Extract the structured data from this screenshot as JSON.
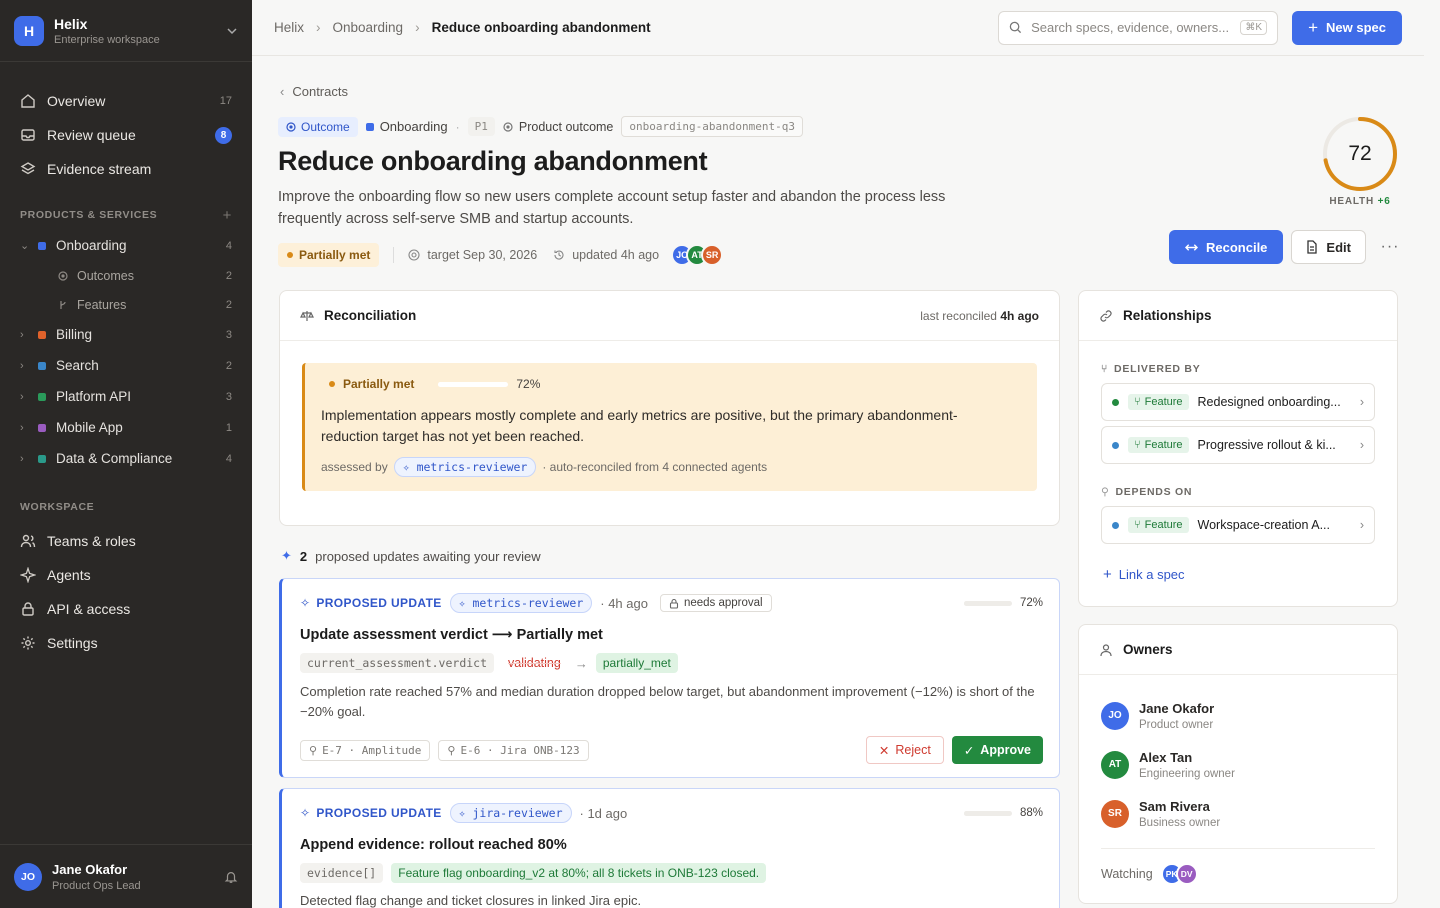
{
  "workspace": {
    "logo_letter": "H",
    "name": "Helix",
    "subtitle": "Enterprise workspace"
  },
  "nav": [
    {
      "label": "Overview",
      "count": "17"
    },
    {
      "label": "Review queue",
      "count": "8"
    },
    {
      "label": "Evidence stream",
      "count": ""
    }
  ],
  "products_header": "PRODUCTS & SERVICES",
  "products": [
    {
      "label": "Onboarding",
      "count": "4",
      "color": "#3f6ce8"
    },
    {
      "label": "Billing",
      "count": "3",
      "color": "#e0622b"
    },
    {
      "label": "Search",
      "count": "2",
      "color": "#3a86c9"
    },
    {
      "label": "Platform API",
      "count": "3",
      "color": "#2a9a5a"
    },
    {
      "label": "Mobile App",
      "count": "1",
      "color": "#9a5cc0"
    },
    {
      "label": "Data & Compliance",
      "count": "4",
      "color": "#2a9a8a"
    }
  ],
  "onboarding_children": [
    {
      "label": "Outcomes",
      "count": "2"
    },
    {
      "label": "Features",
      "count": "2"
    }
  ],
  "workspace_header": "WORKSPACE",
  "workspace_nav": [
    "Teams & roles",
    "Agents",
    "API & access",
    "Settings"
  ],
  "user": {
    "initials": "JO",
    "name": "Jane Okafor",
    "role": "Product Ops Lead"
  },
  "breadcrumbs": [
    "Helix",
    "Onboarding",
    "Reduce onboarding abandonment"
  ],
  "search": {
    "placeholder": "Search specs, evidence, owners...",
    "shortcut": "⌘K"
  },
  "new_spec_label": "New spec",
  "back_label": "Contracts",
  "tags": {
    "type": "Outcome",
    "product": "Onboarding",
    "priority": "P1",
    "kind": "Product outcome",
    "slug": "onboarding-abandonment-q3"
  },
  "title": "Reduce onboarding abandonment",
  "description": "Improve the onboarding flow so new users complete account setup faster and abandon the process less frequently across self-serve SMB and startup accounts.",
  "status": "Partially met",
  "target": "target Sep 30, 2026",
  "updated": "updated 4h ago",
  "header_avatars": [
    {
      "initials": "JO",
      "color": "#3f6ce8"
    },
    {
      "initials": "AT",
      "color": "#238a3f"
    },
    {
      "initials": "SR",
      "color": "#d8602b"
    }
  ],
  "health": {
    "score": 72,
    "label": "HEALTH",
    "delta": "+6",
    "color": "#d98a17"
  },
  "actions": {
    "reconcile": "Reconcile",
    "edit": "Edit"
  },
  "reconciliation": {
    "title": "Reconciliation",
    "last_prefix": "last reconciled",
    "last_value": "4h ago",
    "status": "Partially met",
    "progress": 72,
    "progress_label": "72%",
    "text": "Implementation appears mostly complete and early metrics are positive, but the primary abandonment-reduction target has not yet been reached.",
    "assessed_by": "assessed by",
    "agent": "metrics-reviewer",
    "note": "· auto-reconciled from 4 connected agents"
  },
  "proposed": {
    "count": "2",
    "label": "proposed updates awaiting your review"
  },
  "updates": [
    {
      "label": "PROPOSED UPDATE",
      "agent": "metrics-reviewer",
      "time": "· 4h ago",
      "approval": "needs approval",
      "confidence": 72,
      "confidence_label": "72%",
      "title": "Update assessment verdict ⟶ Partially met",
      "field": "current_assessment.verdict",
      "old": "validating",
      "new": "partially_met",
      "text": "Completion rate reached 57% and median duration dropped below target, but abandonment improvement (−12%) is short of the −20% goal.",
      "evidence": [
        "E-7 · Amplitude",
        "E-6 · Jira ONB-123"
      ],
      "reject": "Reject",
      "approve": "Approve"
    },
    {
      "label": "PROPOSED UPDATE",
      "agent": "jira-reviewer",
      "time": "· 1d ago",
      "confidence": 88,
      "confidence_label": "88%",
      "title": "Append evidence: rollout reached 80%",
      "field": "evidence[]",
      "new": "Feature flag onboarding_v2 at 80%; all 8 tickets in ONB-123 closed.",
      "text": "Detected flag change and ticket closures in linked Jira epic."
    }
  ],
  "relationships": {
    "title": "Relationships",
    "delivered_header": "DELIVERED BY",
    "delivered": [
      {
        "type": "Feature",
        "name": "Redesigned onboarding...",
        "dot": "#238a3f"
      },
      {
        "type": "Feature",
        "name": "Progressive rollout & ki...",
        "dot": "#3a86c9"
      }
    ],
    "depends_header": "DEPENDS ON",
    "depends": [
      {
        "type": "Feature",
        "name": "Workspace-creation A...",
        "dot": "#3a86c9"
      }
    ],
    "link_label": "Link a spec"
  },
  "owners": {
    "title": "Owners",
    "list": [
      {
        "initials": "JO",
        "name": "Jane Okafor",
        "role": "Product owner",
        "color": "#3f6ce8"
      },
      {
        "initials": "AT",
        "name": "Alex Tan",
        "role": "Engineering owner",
        "color": "#238a3f"
      },
      {
        "initials": "SR",
        "name": "Sam Rivera",
        "role": "Business owner",
        "color": "#d8602b"
      }
    ],
    "watching_label": "Watching",
    "watchers": [
      {
        "initials": "PK",
        "color": "#3f6ce8"
      },
      {
        "initials": "DV",
        "color": "#9a5cc0"
      }
    ]
  }
}
